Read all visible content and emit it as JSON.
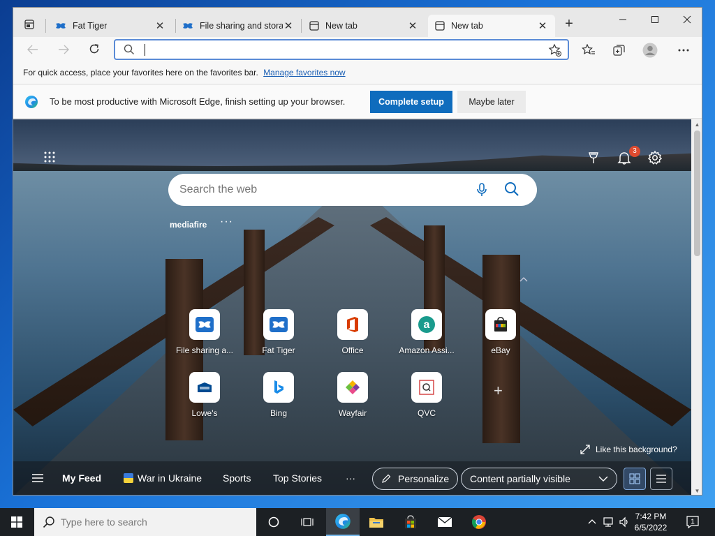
{
  "browser": {
    "tabs": [
      {
        "title": "Fat Tiger",
        "icon": "mediafire-icon"
      },
      {
        "title": "File sharing and storage",
        "icon": "mediafire-icon"
      },
      {
        "title": "New tab",
        "icon": "newtab-icon"
      },
      {
        "title": "New tab",
        "icon": "newtab-icon",
        "active": true
      }
    ],
    "close_glyph": "✕",
    "address_value": "",
    "favorites_bar": {
      "message": "For quick access, place your favorites here on the favorites bar.",
      "link": "Manage favorites now"
    },
    "infobar": {
      "message": "To be most productive with Microsoft Edge, finish setting up your browser.",
      "primary": "Complete setup",
      "secondary": "Maybe later"
    }
  },
  "newtab": {
    "search_placeholder": "Search the web",
    "notification_count": "3",
    "quicklinks_label": "mediafire",
    "quicklinks_more": "···",
    "tiles": [
      {
        "label": "File sharing a...",
        "icon": "mediafire-icon"
      },
      {
        "label": "Fat Tiger",
        "icon": "mediafire-icon"
      },
      {
        "label": "Office",
        "icon": "office-icon"
      },
      {
        "label": "Amazon Assi...",
        "icon": "amazon-icon"
      },
      {
        "label": "eBay",
        "icon": "ebay-icon"
      },
      {
        "label": "Lowe's",
        "icon": "lowes-icon"
      },
      {
        "label": "Bing",
        "icon": "bing-icon"
      },
      {
        "label": "Wayfair",
        "icon": "wayfair-icon"
      },
      {
        "label": "QVC",
        "icon": "qvc-icon"
      }
    ],
    "add_glyph": "+",
    "like_background": "Like this background?",
    "feed": {
      "items": [
        "My Feed",
        "War in Ukraine",
        "Sports",
        "Top Stories",
        "···"
      ],
      "personalize": "Personalize",
      "visibility": "Content partially visible"
    }
  },
  "taskbar": {
    "search_placeholder": "Type here to search",
    "time": "7:42 PM",
    "date": "6/5/2022",
    "notification_count": "1"
  },
  "colors": {
    "accent": "#0f6cbd",
    "mediafire": "#1f6fc9",
    "office": "#d83b01",
    "amazon": "#1a9b8d",
    "badge": "#e04b2f"
  }
}
